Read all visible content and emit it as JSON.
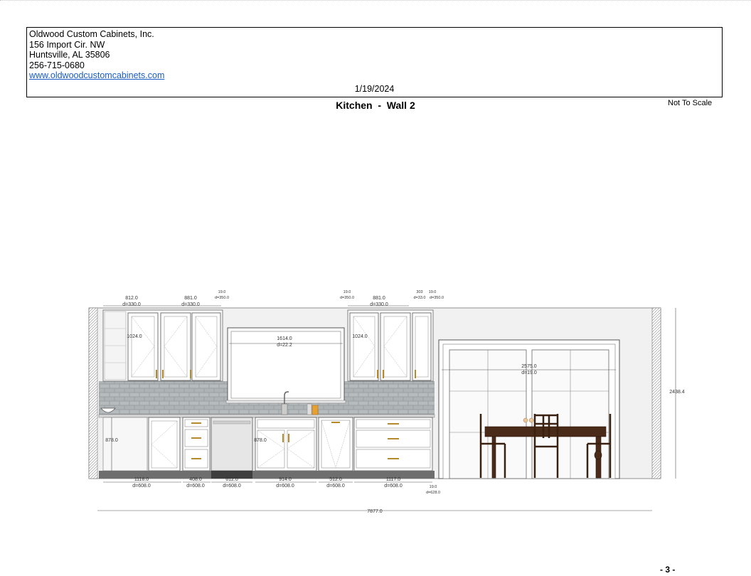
{
  "company": {
    "name": "Oldwood Custom Cabinets, Inc.",
    "street": "156 Import Cir. NW",
    "city": "Huntsville, AL 35806",
    "phone": "256-715-0680",
    "website": "www.oldwoodcustomcabinets.com"
  },
  "date": "1/19/2024",
  "title": "Kitchen  -  Wall 2",
  "scale_note": "Not To Scale",
  "page_number": "- 3 -",
  "dimensions": {
    "upper_left_1_width": "812.0",
    "upper_left_1_depth": "d=330.0",
    "upper_left_2_width": "881.0",
    "upper_left_2_depth": "d=330.0",
    "upper_left_filler_width": "19.0",
    "upper_left_filler_depth": "d=350.0",
    "upper_right_filler_width": "19.0",
    "upper_right_filler_depth": "d=350.0",
    "upper_right_1_width": "881.0",
    "upper_right_1_depth": "d=330.0",
    "upper_right_small_width": "303",
    "upper_right_small_depth": "d=33.0",
    "upper_right_end_width": "19.0",
    "upper_right_end_depth": "d=350.0",
    "upper_left_height": "1024.0",
    "upper_right_height": "1024.0",
    "window_width": "1614.0",
    "window_depth": "d=22.2",
    "door_width": "2575.0",
    "door_depth": "d=19.0",
    "wall_height": "2438.4",
    "base_left_height": "878.0",
    "base_mid_height": "878.0",
    "base_1_width": "1118.0",
    "base_1_depth": "d=608.0",
    "base_2_width": "408.0",
    "base_2_depth": "d=608.0",
    "base_3_width": "612.0",
    "base_3_depth": "d=608.0",
    "base_4_width": "914.0",
    "base_4_depth": "d=608.0",
    "base_5_width": "512.0",
    "base_5_depth": "d=608.0",
    "base_6_width": "1117.0",
    "base_6_depth": "d=608.0",
    "base_end_width": "19.0",
    "base_end_depth": "d=628.0",
    "total_width": "7877.0"
  }
}
